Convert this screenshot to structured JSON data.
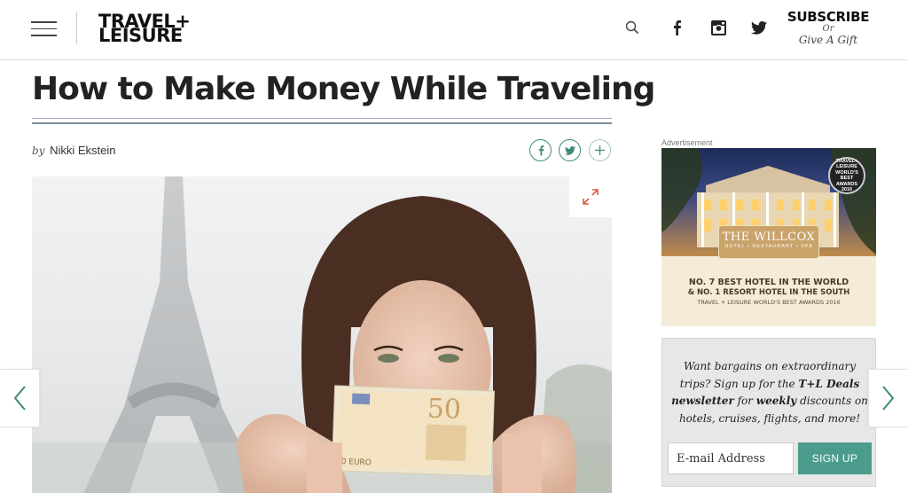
{
  "header": {
    "logo_line1": "TRAVEL+",
    "logo_line2": "LEISURE",
    "icons": [
      "search-icon",
      "facebook-icon",
      "instagram-icon",
      "twitter-icon"
    ],
    "subscribe_label": "SUBSCRIBE",
    "or_label": "Or",
    "gift_label": "Give A Gift"
  },
  "article": {
    "title": "How to Make Money While Traveling",
    "by_label": "by",
    "author": "Nikki Ekstein",
    "share_icons": [
      "facebook-share-icon",
      "twitter-share-icon",
      "more-share-icon"
    ]
  },
  "advertisement": {
    "label": "Advertisement",
    "badge_lines": [
      "TRAVEL+",
      "LEISURE",
      "WORLD'S",
      "BEST",
      "AWARDS",
      "2016"
    ],
    "hotel_name": "THE WILLCOX",
    "hotel_subtitle": "HOTEL • RESTAURANT • SPA",
    "line1": "NO. 7 BEST HOTEL IN THE WORLD",
    "line2": "& NO. 1 RESORT HOTEL IN THE SOUTH",
    "line3": "TRAVEL + LEISURE WORLD'S BEST AWARDS 2016"
  },
  "newsletter": {
    "text_part1": "Want bargains on extraordinary trips? Sign up for the ",
    "text_bold1": "T+L Deals newsletter",
    "text_part2": " for ",
    "text_bold2": "weekly",
    "text_part3": " discounts on hotels, cruises, flights, and more!",
    "email_placeholder": "E-mail Address",
    "signup_label": "SIGN UP"
  },
  "colors": {
    "accent_teal": "#4c9c8e",
    "share_teal": "#3e8a7c",
    "rule_blue": "#7d8d9e",
    "expand_orange": "#e05a3a"
  }
}
